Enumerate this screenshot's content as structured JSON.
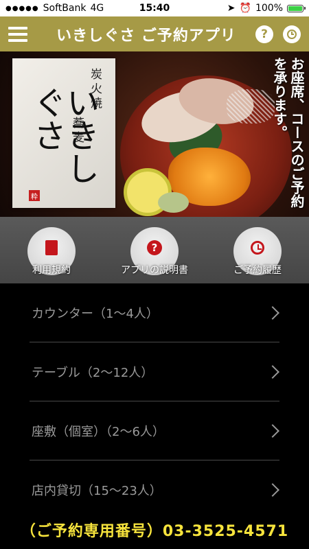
{
  "status": {
    "carrier": "SoftBank",
    "network": "4G",
    "time": "15:40",
    "battery": "100%",
    "battery_level": 1.0
  },
  "header": {
    "title": "いきしぐさ ご予約アプリ"
  },
  "hero": {
    "logo_small_1": "炭火焼",
    "logo_small_2": "蕎麦",
    "logo_main": "いきしぐさ",
    "seal": "粋",
    "caption": "お座席、コースのご予約を承ります。"
  },
  "quick_actions": [
    {
      "label": "利用規約",
      "icon": "book-icon"
    },
    {
      "label": "アプリの説明書",
      "icon": "help-icon"
    },
    {
      "label": "ご予約履歴",
      "icon": "clock-icon"
    }
  ],
  "reservation_options": [
    {
      "label": "カウンター（1〜4人）"
    },
    {
      "label": "テーブル（2〜12人）"
    },
    {
      "label": "座敷（個室）（2〜6人）"
    },
    {
      "label": "店内貸切（15〜23人）"
    }
  ],
  "footer": {
    "phone_line": "（ご予約専用番号）03-3525-4571"
  },
  "colors": {
    "header_bg": "#a69a46",
    "accent_red": "#c4161c",
    "phone_yellow": "#f6e33c"
  }
}
